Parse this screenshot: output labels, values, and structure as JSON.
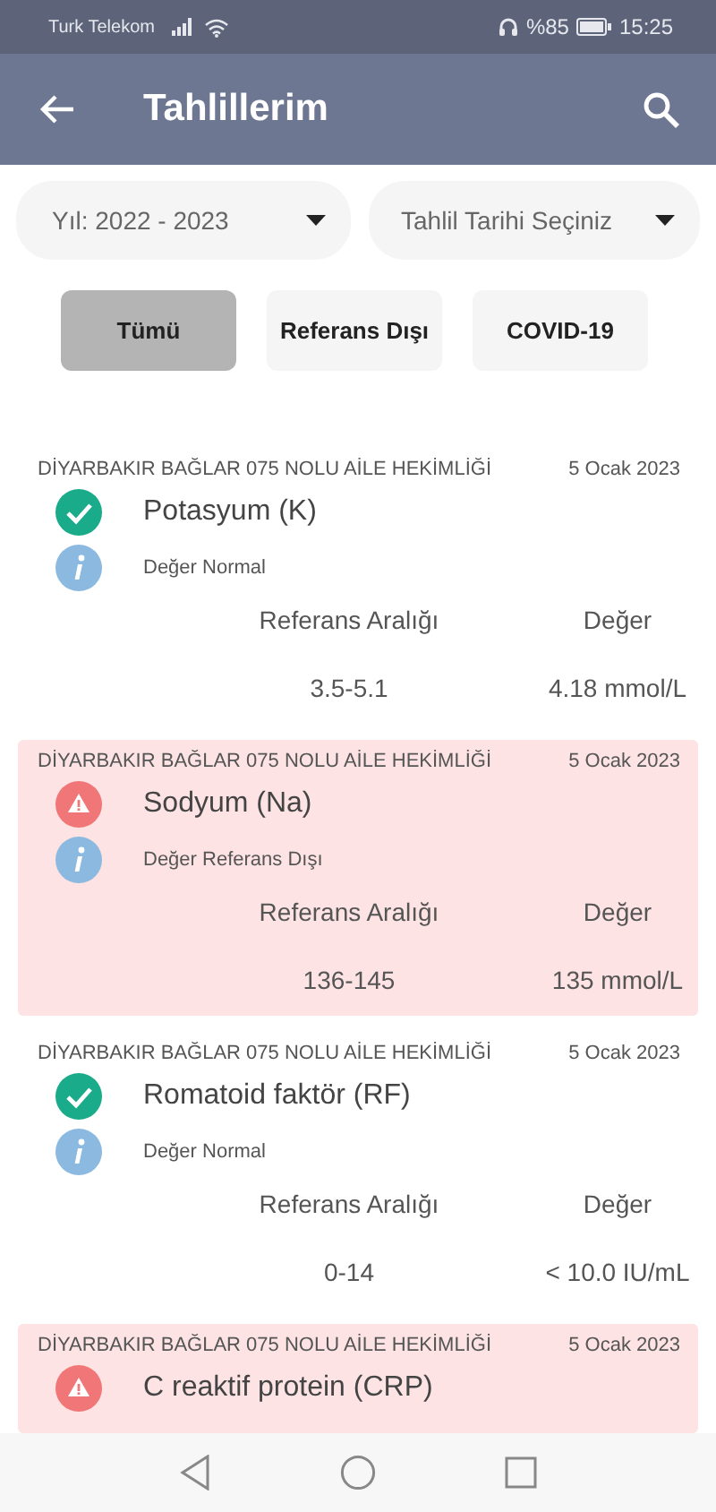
{
  "status_bar": {
    "carrier": "Turk Telekom",
    "battery": "%85",
    "time": "15:25"
  },
  "app_bar": {
    "title": "Tahlillerim"
  },
  "filters": [
    {
      "label": "Yıl: 2022 - 2023"
    },
    {
      "label": "Tahlil Tarihi Seçiniz"
    }
  ],
  "chips": [
    {
      "label": "Tümü",
      "selected": true
    },
    {
      "label": "Referans Dışı",
      "selected": false
    },
    {
      "label": "COVID-19",
      "selected": false
    }
  ],
  "results": [
    {
      "kind": "normal",
      "institution": "DİYARBAKIR BAĞLAR 075 NOLU AİLE HEKİMLİĞİ",
      "date": "5 Ocak 2023",
      "name": "Potasyum (K)",
      "status": "Değer Normal",
      "range_label": "Referans Aralığı",
      "value_label": "Değer",
      "range": "3.5-5.1",
      "value": "4.18 mmol/L"
    },
    {
      "kind": "abnormal",
      "institution": "DİYARBAKIR BAĞLAR 075 NOLU AİLE HEKİMLİĞİ",
      "date": "5 Ocak 2023",
      "name": "Sodyum (Na)",
      "status": "Değer Referans Dışı",
      "range_label": "Referans Aralığı",
      "value_label": "Değer",
      "range": "136-145",
      "value": "135 mmol/L"
    },
    {
      "kind": "normal",
      "institution": "DİYARBAKIR BAĞLAR 075 NOLU AİLE HEKİMLİĞİ",
      "date": "5 Ocak 2023",
      "name": "Romatoid faktör (RF)",
      "status": "Değer Normal",
      "range_label": "Referans Aralığı",
      "value_label": "Değer",
      "range": "0-14",
      "value": "< 10.0 IU/mL"
    },
    {
      "kind": "abnormal",
      "institution": "DİYARBAKIR BAĞLAR 075 NOLU AİLE HEKİMLİĞİ",
      "date": "5 Ocak 2023",
      "name": "C reaktif protein (CRP)"
    }
  ]
}
